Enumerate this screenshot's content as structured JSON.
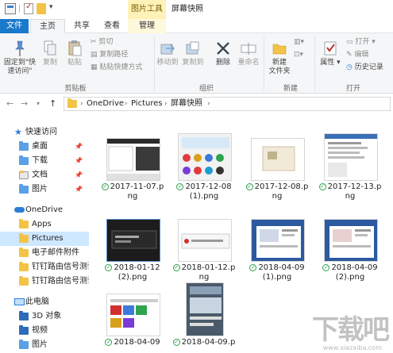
{
  "window": {
    "title": "屏幕快照",
    "context_tab": "图片工具"
  },
  "tabs": {
    "file": "文件",
    "home": "主页",
    "share": "共享",
    "view": "查看",
    "manage": "管理"
  },
  "ribbon": {
    "clipboard": {
      "label": "剪贴板",
      "pin_quick_access": "固定到\"快\n速访问\"",
      "copy": "复制",
      "paste": "粘贴",
      "cut": "剪切",
      "copy_path": "复制路径",
      "paste_shortcut": "粘贴快捷方式"
    },
    "organize": {
      "label": "组织",
      "move_to": "移动到",
      "copy_to": "复制到",
      "delete": "删除",
      "rename": "重命名"
    },
    "new": {
      "label": "新建",
      "new_folder": "新建\n文件夹"
    },
    "open": {
      "label": "打开",
      "properties": "属性",
      "open": "打开",
      "edit": "编辑",
      "history": "历史记录"
    }
  },
  "address": {
    "crumbs": [
      "OneDrive",
      "Pictures",
      "屏幕快照"
    ]
  },
  "nav": {
    "items": [
      {
        "label": "快速访问",
        "icon": "star-icon"
      },
      {
        "label": "桌面",
        "icon": "folder-icon",
        "pinned": true
      },
      {
        "label": "下载",
        "icon": "download-icon",
        "pinned": true
      },
      {
        "label": "文档",
        "icon": "folder-icon",
        "pinned": true
      },
      {
        "label": "图片",
        "icon": "folder-icon",
        "pinned": true
      },
      {
        "label": "OneDrive",
        "icon": "cloud-icon"
      },
      {
        "label": "Apps",
        "icon": "folder-icon"
      },
      {
        "label": "Pictures",
        "icon": "folder-icon"
      },
      {
        "label": "电子邮件附件",
        "icon": "folder-icon"
      },
      {
        "label": "钉钉路由信号测试",
        "icon": "folder-icon"
      },
      {
        "label": "钉钉路由信号测试",
        "icon": "folder-icon"
      },
      {
        "label": "此电脑",
        "icon": "pc-icon"
      },
      {
        "label": "3D 对象",
        "icon": "folder-icon"
      },
      {
        "label": "视频",
        "icon": "folder-icon"
      },
      {
        "label": "图片",
        "icon": "folder-icon"
      }
    ],
    "pin_glyph": "📌"
  },
  "files": [
    {
      "name": "2017-11-07.p\nng"
    },
    {
      "name": "2017-12-08\n(1).png"
    },
    {
      "name": "2017-12-08.p\nng"
    },
    {
      "name": "2017-12-13.p\nng"
    },
    {
      "name": "2018-01-12\n(2).png"
    },
    {
      "name": "2018-01-12.p\nng"
    },
    {
      "name": "2018-04-09\n(1).png"
    },
    {
      "name": "2018-04-09\n(2).png"
    },
    {
      "name": "2018-04-09"
    },
    {
      "name": "2018-04-09.p"
    }
  ],
  "watermark": {
    "text": "下载吧",
    "sub": "www.xiazaiba.com"
  }
}
